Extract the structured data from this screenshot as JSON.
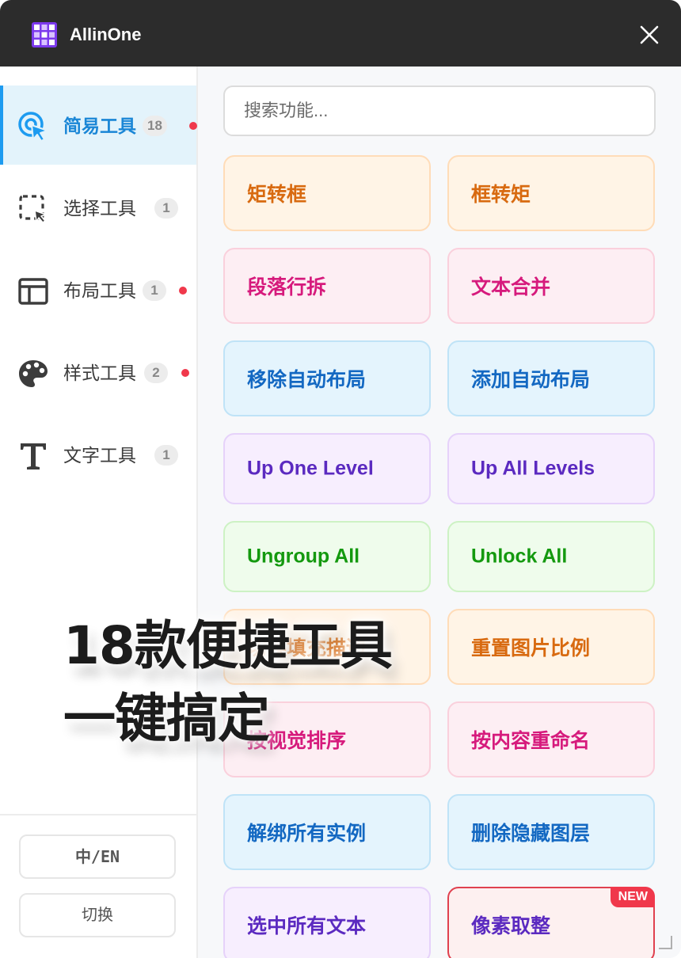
{
  "app": {
    "title": "AllinOne"
  },
  "sidebar": {
    "items": [
      {
        "label": "简易工具",
        "count": "18",
        "has_dot": true,
        "icon": "pointer-click-icon",
        "active": true
      },
      {
        "label": "选择工具",
        "count": "1",
        "has_dot": false,
        "icon": "selection-icon",
        "active": false
      },
      {
        "label": "布局工具",
        "count": "1",
        "has_dot": true,
        "icon": "layout-icon",
        "active": false
      },
      {
        "label": "样式工具",
        "count": "2",
        "has_dot": true,
        "icon": "palette-icon",
        "active": false
      },
      {
        "label": "文字工具",
        "count": "1",
        "has_dot": false,
        "icon": "text-t-icon",
        "active": false
      }
    ],
    "lang_button": "中/EN",
    "switch_button": "切换"
  },
  "search": {
    "placeholder": "搜索功能..."
  },
  "tools": [
    {
      "label": "矩转框",
      "color": "orange"
    },
    {
      "label": "框转矩",
      "color": "orange"
    },
    {
      "label": "段落行拆",
      "color": "pink"
    },
    {
      "label": "文本合并",
      "color": "pink"
    },
    {
      "label": "移除自动布局",
      "color": "blue"
    },
    {
      "label": "添加自动布局",
      "color": "blue"
    },
    {
      "label": "Up One Level",
      "color": "purple"
    },
    {
      "label": "Up All Levels",
      "color": "purple"
    },
    {
      "label": "Ungroup All",
      "color": "green"
    },
    {
      "label": "Unlock All",
      "color": "green"
    },
    {
      "label": "切换填充描边",
      "color": "orange"
    },
    {
      "label": "重置图片比例",
      "color": "orange"
    },
    {
      "label": "按视觉排序",
      "color": "pink"
    },
    {
      "label": "按内容重命名",
      "color": "pink"
    },
    {
      "label": "解绑所有实例",
      "color": "blue"
    },
    {
      "label": "删除隐藏图层",
      "color": "blue"
    },
    {
      "label": "选中所有文本",
      "color": "purple"
    },
    {
      "label": "像素取整",
      "color": "new",
      "badge": "NEW"
    }
  ],
  "overlay": {
    "line1": "18款便捷工具",
    "line2": "一键搞定"
  },
  "colors": {
    "accent": "#1d9bf0",
    "titlebar": "#2c2c2c",
    "notification_dot": "#f0384b",
    "new_badge": "#f0384b"
  }
}
